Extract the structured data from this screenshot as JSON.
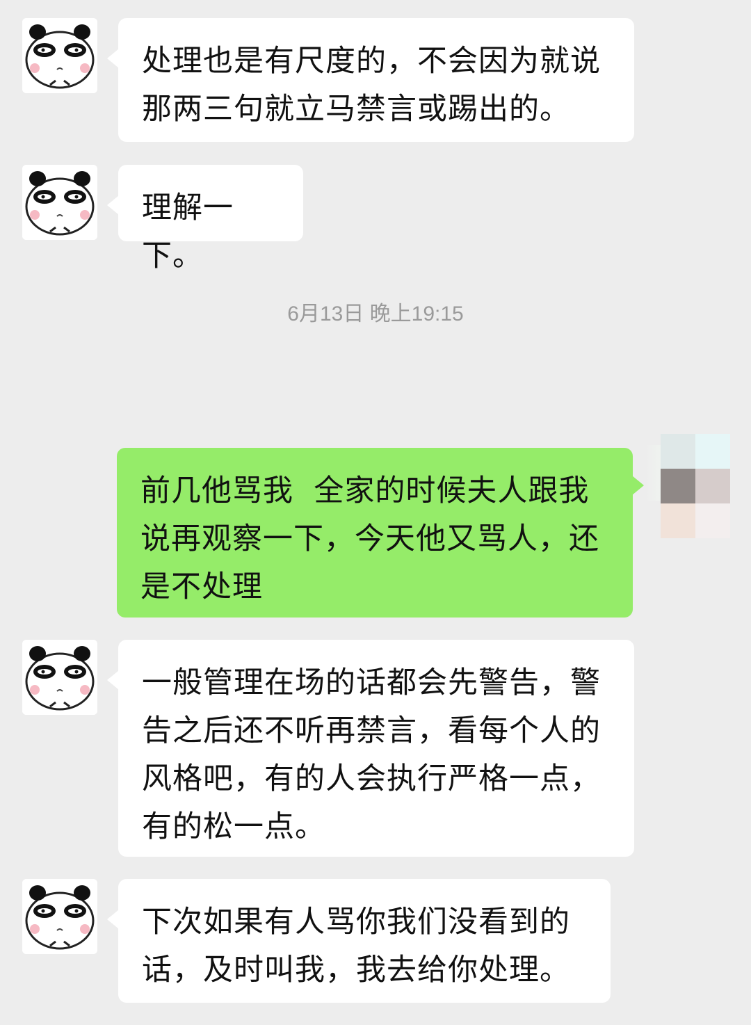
{
  "chat": {
    "messages": [
      {
        "sender": "other",
        "text": "处理也是有尺度的，不会因为就说\n那两三句就立马禁言或踢出的。"
      },
      {
        "sender": "other",
        "text": "理解一下。"
      },
      {
        "type": "timestamp",
        "text": "6月13日 晚上19:15"
      },
      {
        "sender": "me",
        "text": "前几他骂我  全家的时候夫人跟我\n说再观察一下，今天他又骂人，还\n是不处理"
      },
      {
        "sender": "other",
        "text": "一般管理在场的话都会先警告，警\n告之后还不听再禁言，看每个人的\n风格吧，有的人会执行严格一点，\n有的松一点。"
      },
      {
        "sender": "other",
        "text": "下次如果有人骂你我们没看到的\n话，及时叫我，我去给你处理。"
      }
    ]
  },
  "colors": {
    "background": "#ededed",
    "incoming_bubble": "#ffffff",
    "outgoing_bubble": "#95ec69",
    "timestamp_text": "#9a9a9a",
    "mosaic": [
      "#dfe8e8",
      "#e6f6f7",
      "#8f8886",
      "#d6cccb",
      "#f1e2d9",
      "#f3eeee"
    ]
  },
  "icons": {
    "other_avatar": "panda-face-icon",
    "my_avatar": "mosaic-pixelated-avatar"
  }
}
